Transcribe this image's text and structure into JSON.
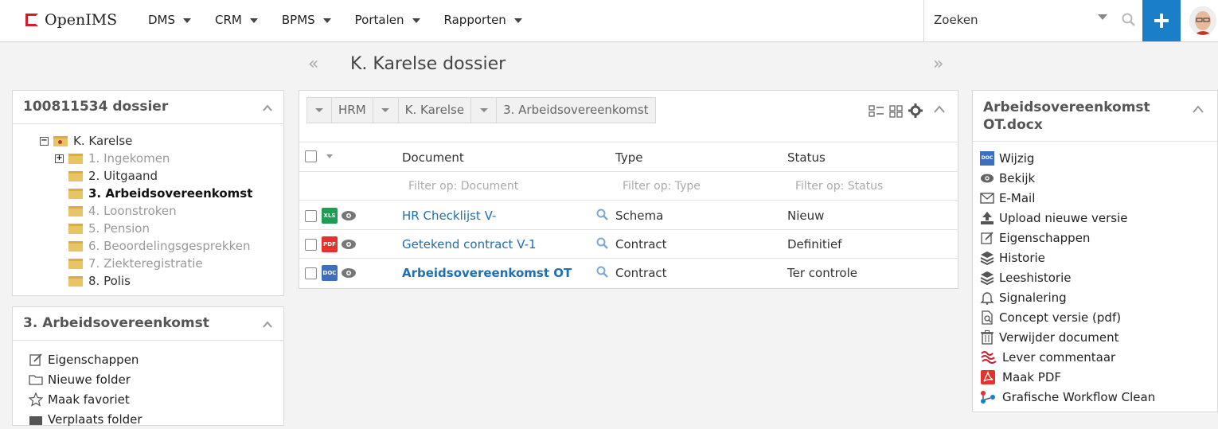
{
  "brand": {
    "name": "OpenIMS",
    "color": "#d21c2b"
  },
  "menu": [
    {
      "label": "DMS"
    },
    {
      "label": "CRM"
    },
    {
      "label": "BPMS"
    },
    {
      "label": "Portalen"
    },
    {
      "label": "Rapporten"
    }
  ],
  "search": {
    "placeholder": "Zoeken"
  },
  "page": {
    "title": "K. Karelse dossier",
    "prev": "«",
    "next": "»"
  },
  "tree_panel": {
    "title": "100811534 dossier",
    "root": "K. Karelse",
    "items": [
      {
        "label": "1. Ingekomen"
      },
      {
        "label": "2. Uitgaand"
      },
      {
        "label": "3. Arbeidsovereenkomst"
      },
      {
        "label": "4. Loonstroken"
      },
      {
        "label": "5. Pension"
      },
      {
        "label": "6. Beoordelingsgesprekken"
      },
      {
        "label": "7. Ziekteregistratie"
      },
      {
        "label": "8. Polis"
      }
    ]
  },
  "folder_panel": {
    "title": "3. Arbeidsovereenkomst",
    "actions": [
      {
        "label": "Eigenschappen"
      },
      {
        "label": "Nieuwe folder"
      },
      {
        "label": "Maak favoriet"
      },
      {
        "label": "Verplaats folder"
      }
    ]
  },
  "documents_panel": {
    "breadcrumb": [
      "HRM",
      "K. Karelse",
      "3. Arbeidsovereenkomst"
    ],
    "columns": {
      "document": "Document",
      "type": "Type",
      "status": "Status"
    },
    "filters": {
      "document": "Filter op: Document",
      "type": "Filter op: Type",
      "status": "Filter op: Status"
    },
    "rows": [
      {
        "badge": "XLS",
        "badge_color": "#1f9d55",
        "name": "HR Checklijst V-",
        "type": "Schema",
        "status": "Nieuw"
      },
      {
        "badge": "PDF",
        "badge_color": "#e5322d",
        "name": "Getekend contract V-1",
        "type": "Contract",
        "status": "Definitief"
      },
      {
        "badge": "DOC",
        "badge_color": "#3d6fbf",
        "name": "Arbeidsovereenkomst OT",
        "type": "Contract",
        "status": "Ter controle"
      }
    ]
  },
  "doc_actions_panel": {
    "title_line1": "Arbeidsovereenkomst",
    "title_line2": "OT.docx",
    "doc_badge": "DOC",
    "actions": [
      {
        "label": "Wijzig"
      },
      {
        "label": "Bekijk"
      },
      {
        "label": "E-Mail"
      },
      {
        "label": "Upload nieuwe versie"
      },
      {
        "label": "Eigenschappen"
      },
      {
        "label": "Historie"
      },
      {
        "label": "Leeshistorie"
      },
      {
        "label": "Signalering"
      },
      {
        "label": "Concept versie (pdf)"
      },
      {
        "label": "Verwijder document"
      },
      {
        "label": "Lever commentaar"
      },
      {
        "label": "Maak PDF"
      },
      {
        "label": "Grafische Workflow Clean"
      }
    ]
  },
  "colors": {
    "accent": "#1a7ec9",
    "link": "#1f6fb2"
  }
}
